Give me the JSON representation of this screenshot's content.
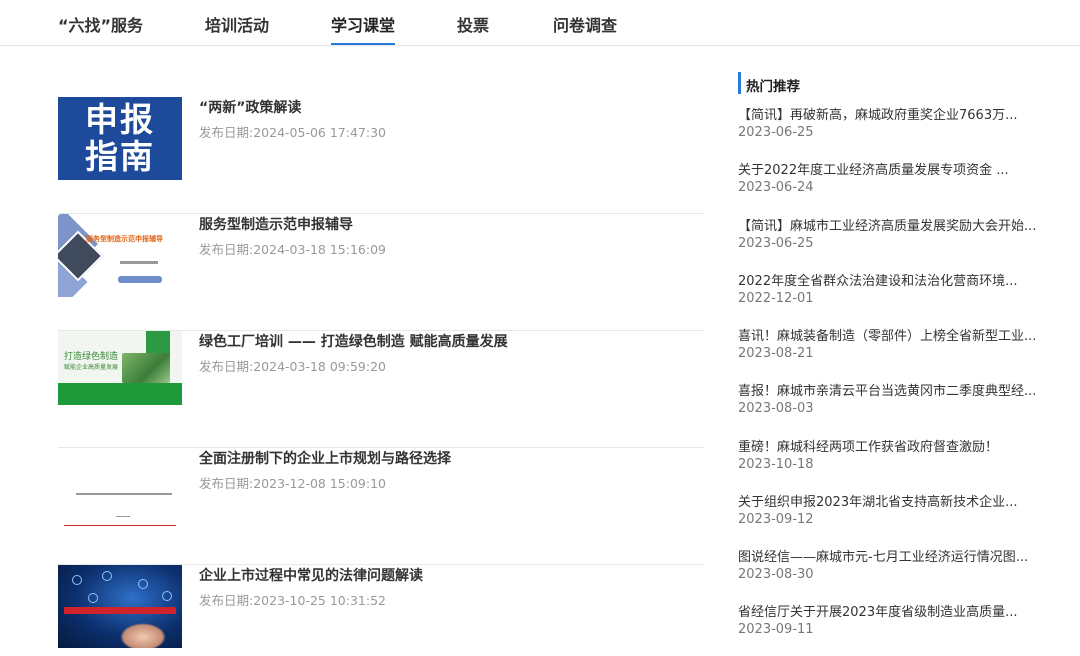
{
  "nav": {
    "tabs": [
      {
        "label": "“六找”服务"
      },
      {
        "label": "培训活动"
      },
      {
        "label": "学习课堂"
      },
      {
        "label": "投票"
      },
      {
        "label": "问卷调查"
      }
    ],
    "active_tab": "学习课堂"
  },
  "articles": [
    {
      "title": "“两新”政策解读",
      "date": "发布日期:2024-05-06 17:47:30",
      "thumb_text": [
        "申报",
        "指南"
      ]
    },
    {
      "title": "服务型制造示范申报辅导",
      "date": "发布日期:2024-03-18 15:16:09",
      "thumb_text": [
        "服务型制造示范申报辅导"
      ]
    },
    {
      "title": "绿色工厂培训 —— 打造绿色制造 赋能高质量发展",
      "date": "发布日期:2024-03-18 09:59:20",
      "thumb_text": [
        "打造绿色制造",
        "赋能企业高质量发展"
      ]
    },
    {
      "title": "全面注册制下的企业上市规划与路径选择",
      "date": "发布日期:2023-12-08 15:09:10",
      "thumb_text": []
    },
    {
      "title": "企业上市过程中常见的法律问题解读",
      "date": "发布日期:2023-10-25 10:31:52",
      "thumb_text": []
    }
  ],
  "sidebar": {
    "title": "热门推荐",
    "items": [
      {
        "title": "【简讯】再破新高，麻城政府重奖企业7663万...",
        "date": "2023-06-25"
      },
      {
        "title": "关于2022年度工业经济高质量发展专项资金 ...",
        "date": "2023-06-24"
      },
      {
        "title": "【简讯】麻城市工业经济高质量发展奖励大会开始...",
        "date": "2023-06-25"
      },
      {
        "title": "2022年度全省群众法治建设和法治化营商环境...",
        "date": "2022-12-01"
      },
      {
        "title": "喜讯！麻城装备制造（零部件）上榜全省新型工业...",
        "date": "2023-08-21"
      },
      {
        "title": "喜报！麻城市亲清云平台当选黄冈市二季度典型经...",
        "date": "2023-08-03"
      },
      {
        "title": "重磅！麻城科经两项工作获省政府督查激励！",
        "date": "2023-10-18"
      },
      {
        "title": "关于组织申报2023年湖北省支持高新技术企业...",
        "date": "2023-09-12"
      },
      {
        "title": "图说经信——麻城市元-七月工业经济运行情况图...",
        "date": "2023-08-30"
      },
      {
        "title": "省经信厅关于开展2023年度省级制造业高质量...",
        "date": "2023-09-11"
      }
    ]
  },
  "colors": {
    "accent": "#2a7ad9",
    "thumb1_bg": "#1e4a9c",
    "date_gray": "#999999"
  }
}
